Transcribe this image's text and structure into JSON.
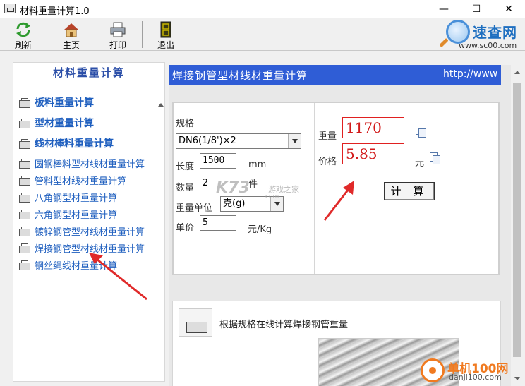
{
  "window": {
    "title": "材料重量计算1.0",
    "minimize_glyph": "—",
    "maximize_glyph": "☐",
    "close_glyph": "✕"
  },
  "toolbar": {
    "refresh_label": "刷新",
    "home_label": "主页",
    "print_label": "打印",
    "exit_label": "退出"
  },
  "logo": {
    "text": "速查网",
    "url": "www.sc00.com"
  },
  "sidebar": {
    "heading": "材料重量计算",
    "items": [
      {
        "label": "板料重量计算",
        "size": "big"
      },
      {
        "label": "型材重量计算",
        "size": "big"
      },
      {
        "label": "线材棒料重量计算",
        "size": "big"
      },
      {
        "label": "圆钢棒料型材线材重量计算",
        "size": "small"
      },
      {
        "label": "管料型材线材重量计算",
        "size": "small"
      },
      {
        "label": "八角钢型材重量计算",
        "size": "small"
      },
      {
        "label": "六角钢型材重量计算",
        "size": "small"
      },
      {
        "label": "镀锌钢管型材线材重量计算",
        "size": "small"
      },
      {
        "label": "焊接钢管型材线材重量计算",
        "size": "small"
      },
      {
        "label": "钢丝绳线材重量计算",
        "size": "small"
      }
    ]
  },
  "content": {
    "banner_title": "焊接钢管型材线材重量计算",
    "banner_url": "http://www",
    "form": {
      "spec_label": "规格",
      "spec_value": "DN6(1/8')×2",
      "length_label": "长度",
      "length_value": "1500",
      "length_unit": "mm",
      "quantity_label": "数量",
      "quantity_value": "2",
      "quantity_unit": "件",
      "weight_unit_label": "重量单位",
      "weight_unit_value": "克(g)",
      "unit_price_label": "单价",
      "unit_price_value": "5",
      "unit_price_unit": "元/Kg"
    },
    "results": {
      "weight_label": "重量",
      "weight_value": "1170",
      "price_label": "价格",
      "price_value": "5.85",
      "price_unit": "元",
      "calc_button_label": "计 算"
    },
    "lower": {
      "description": "根据规格在线计算焊接钢管重量"
    }
  },
  "watermarks": {
    "kz_logo": "K73",
    "kz_sub": "游戏之家",
    "kz_url": "com",
    "danji_text": "单机100网",
    "danji_url": "danji100.com"
  },
  "colors": {
    "banner": "#2f5dd6",
    "link": "#1f5fbf",
    "result_red": "#d21a1a",
    "annotation": "#e02a2a"
  }
}
